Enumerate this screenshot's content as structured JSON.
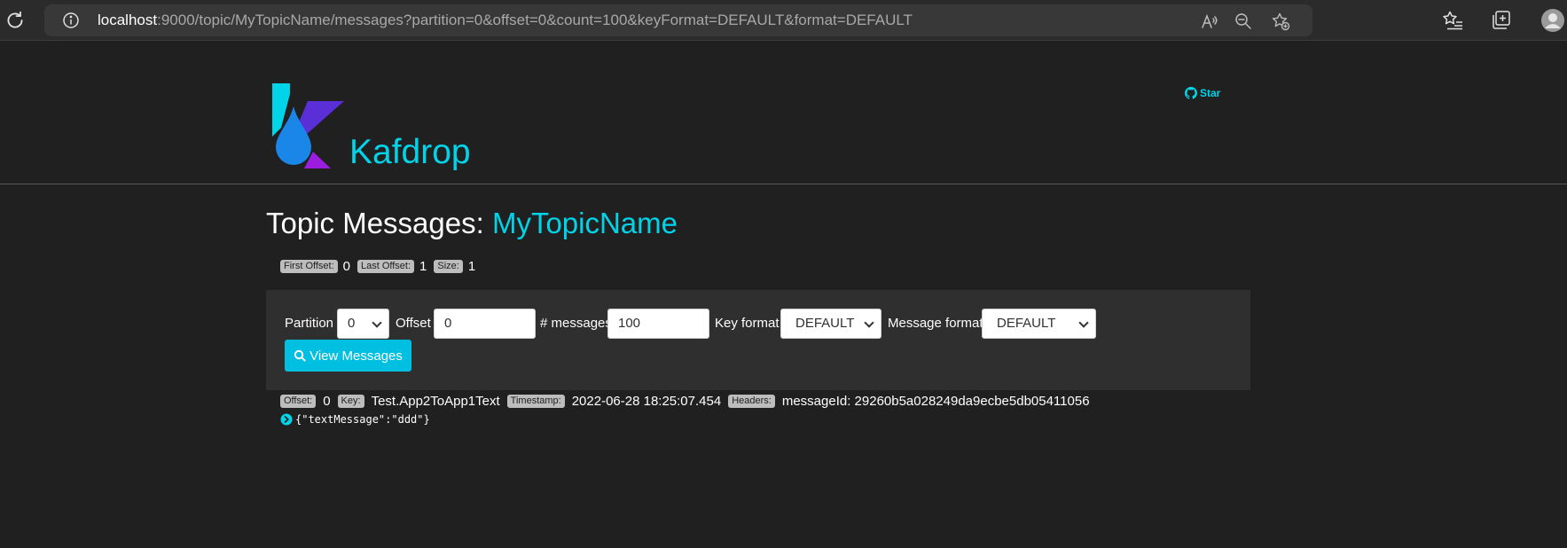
{
  "browser": {
    "url_host": "localhost",
    "url_rest": ":9000/topic/MyTopicName/messages?partition=0&offset=0&count=100&keyFormat=DEFAULT&format=DEFAULT"
  },
  "header": {
    "brand": "Kafdrop",
    "star_label": "Star"
  },
  "page": {
    "title_prefix": "Topic Messages: ",
    "topic_name": "MyTopicName"
  },
  "stats": {
    "first_offset_label": "First Offset:",
    "first_offset_value": "0",
    "last_offset_label": "Last Offset:",
    "last_offset_value": "1",
    "size_label": "Size:",
    "size_value": "1"
  },
  "form": {
    "partition_label": "Partition",
    "partition_value": "0",
    "offset_label": "Offset",
    "offset_value": "0",
    "messages_label": "# messages",
    "messages_value": "100",
    "key_format_label": "Key format",
    "key_format_value": "DEFAULT",
    "message_format_label": "Message format",
    "message_format_value": "DEFAULT",
    "view_button": "View Messages"
  },
  "message": {
    "offset_label": "Offset:",
    "offset_value": "0",
    "key_label": "Key:",
    "key_value": "Test.App2ToApp1Text",
    "timestamp_label": "Timestamp:",
    "timestamp_value": "2022-06-28 18:25:07.454",
    "headers_label": "Headers:",
    "headers_value": "messageId: 29260b5a028249da9ecbe5db05411056",
    "payload": "{\"textMessage\":\"ddd\"}"
  },
  "colors": {
    "accent": "#00d4e8",
    "button": "#00bfe0",
    "background": "#202020",
    "panel": "#2f2f2f"
  }
}
